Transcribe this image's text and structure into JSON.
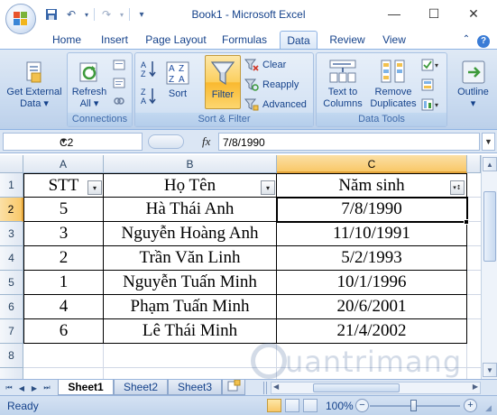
{
  "window": {
    "title": "Book1 - Microsoft Excel",
    "controls": {
      "minimize": "—",
      "maximize": "☐",
      "close": "✕"
    }
  },
  "quick_access": {
    "save": "💾",
    "undo": "↶",
    "redo": "↷",
    "customize": "▾"
  },
  "ribbon": {
    "tabs": [
      "Home",
      "Insert",
      "Page Layout",
      "Formulas",
      "Data",
      "Review",
      "View"
    ],
    "active_tab": "Data",
    "groups": {
      "external": {
        "button": "Get External Data",
        "line1": "Get External",
        "line2": "Data ▾"
      },
      "connections": {
        "label": "Connections",
        "refresh_line1": "Refresh",
        "refresh_line2": "All ▾"
      },
      "sort_filter": {
        "label": "Sort & Filter",
        "sort": "Sort",
        "filter": "Filter",
        "clear": "Clear",
        "reapply": "Reapply",
        "advanced": "Advanced"
      },
      "data_tools": {
        "label": "Data Tools",
        "text_to_columns_1": "Text to",
        "text_to_columns_2": "Columns",
        "remove_duplicates_1": "Remove",
        "remove_duplicates_2": "Duplicates"
      },
      "outline": {
        "button": "Outline",
        "arrow": "▾"
      }
    }
  },
  "formula_bar": {
    "name_box": "C2",
    "fx": "fx",
    "value": "7/8/1990"
  },
  "sheet": {
    "columns": [
      "A",
      "B",
      "C"
    ],
    "rows": [
      "1",
      "2",
      "3",
      "4",
      "5",
      "6",
      "7",
      "8"
    ],
    "headers": [
      "STT",
      "Họ Tên",
      "Năm sinh"
    ],
    "filter_glyphs": [
      "▾",
      "▾",
      "▾↕"
    ],
    "data": [
      [
        "5",
        "Hà Thái Anh",
        "7/8/1990"
      ],
      [
        "3",
        "Nguyễn Hoàng Anh",
        "11/10/1991"
      ],
      [
        "2",
        "Trần Văn Linh",
        "5/2/1993"
      ],
      [
        "1",
        "Nguyễn Tuấn Minh",
        "10/1/1996"
      ],
      [
        "4",
        "Phạm Tuấn Minh",
        "20/6/2001"
      ],
      [
        "6",
        "Lê Thái Minh",
        "21/4/2002"
      ]
    ]
  },
  "sheet_tabs": [
    "Sheet1",
    "Sheet2",
    "Sheet3"
  ],
  "active_sheet": "Sheet1",
  "status": {
    "ready": "Ready",
    "zoom": "100%",
    "zoom_minus": "−",
    "zoom_plus": "+"
  },
  "watermark": "uantrimang",
  "colors": {
    "accent": "#15428b",
    "ribbon": "#c7d9ef",
    "selection": "#f9c868"
  }
}
